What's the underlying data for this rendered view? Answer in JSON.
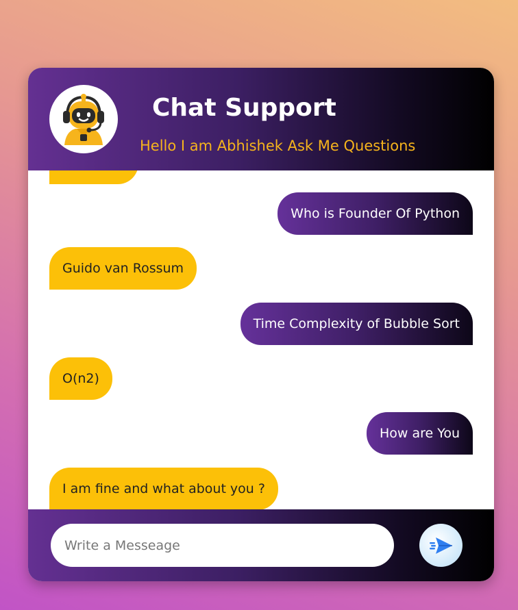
{
  "header": {
    "title": "Chat Support",
    "subtitle": "Hello I am Abhishek Ask Me Questions",
    "avatar_icon": "robot-support-agent-icon"
  },
  "messages": [
    {
      "sender": "bot",
      "text": ""
    },
    {
      "sender": "user",
      "text": "Who is Founder Of Python"
    },
    {
      "sender": "bot",
      "text": "Guido van Rossum"
    },
    {
      "sender": "user",
      "text": "Time Complexity of Bubble Sort"
    },
    {
      "sender": "bot",
      "text": "O(n2)"
    },
    {
      "sender": "user",
      "text": "How are You"
    },
    {
      "sender": "bot",
      "text": "I am fine and what about you ?"
    }
  ],
  "composer": {
    "placeholder": "Write a Messeage",
    "send_icon": "paper-plane-icon"
  },
  "colors": {
    "accent_yellow": "#fcc008",
    "header_purple": "#643092",
    "header_dark": "#000000",
    "send_icon_blue": "#2f7ff0"
  }
}
